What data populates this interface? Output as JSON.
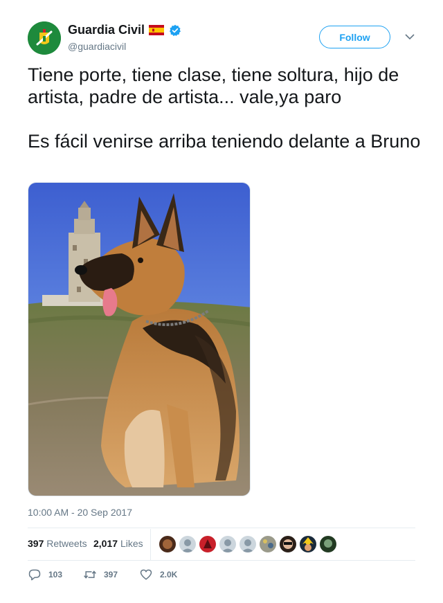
{
  "author": {
    "display_name": "Guardia Civil",
    "handle": "@guardiacivil",
    "verified": true,
    "avatar_color": "#1e8a3c"
  },
  "header": {
    "follow_label": "Follow",
    "accent_color": "#1da1f2"
  },
  "tweet": {
    "paragraph_1": "Tiene porte, tiene clase, tiene soltura, hijo de artista, padre de artista... vale,ya paro",
    "paragraph_2": "Es fácil venirse arriba teniendo delante a Bruno",
    "timestamp": "10:00 AM - 20 Sep 2017"
  },
  "stats": {
    "retweets_count": "397",
    "retweets_label": "Retweets",
    "likes_count": "2,017",
    "likes_label": "Likes"
  },
  "actions": {
    "reply_count": "103",
    "retweet_count": "397",
    "like_count": "2.0K"
  }
}
